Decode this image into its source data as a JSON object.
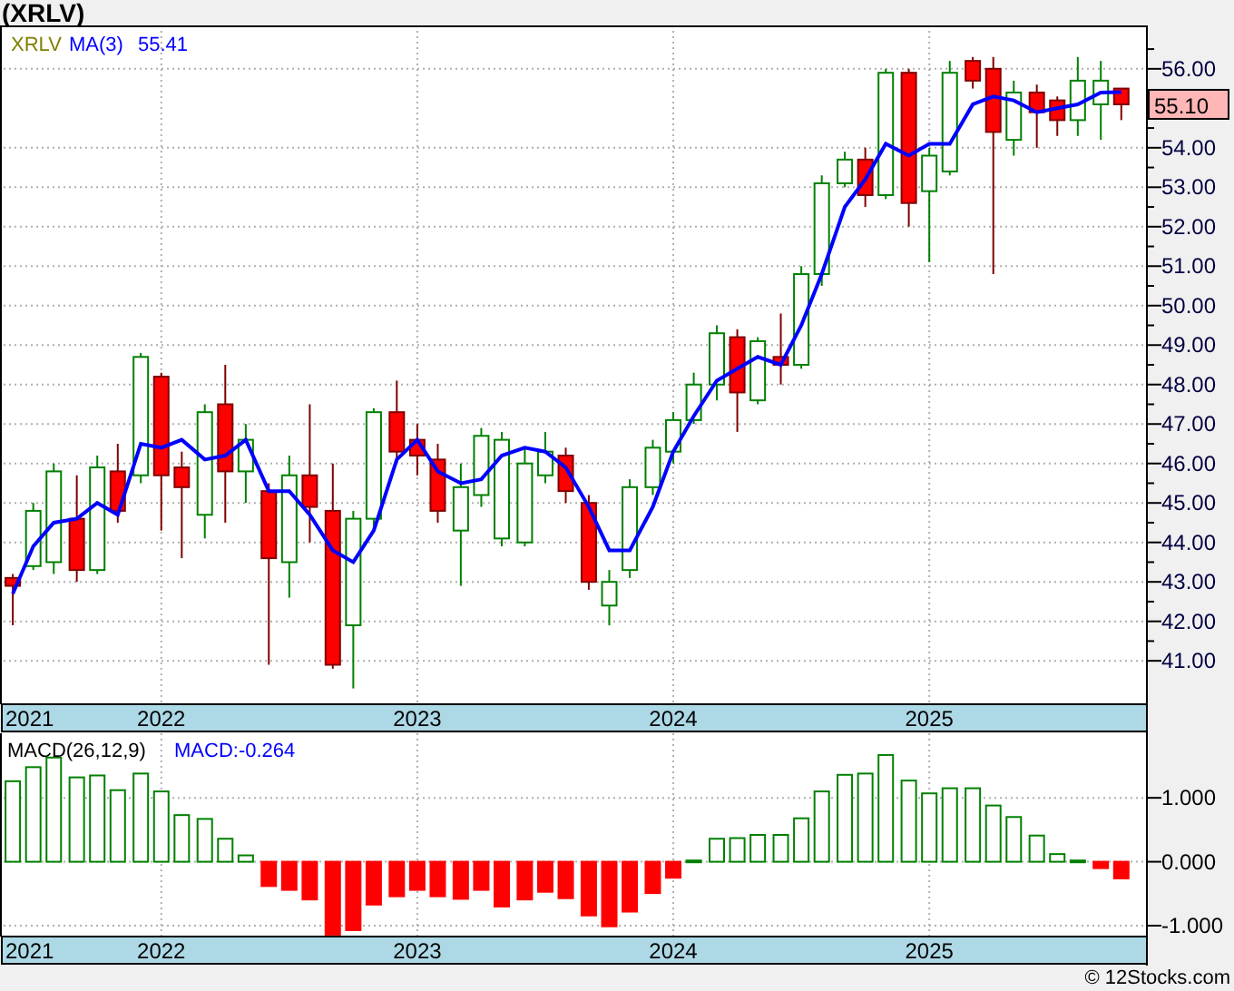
{
  "title": "(XRLV)",
  "price_panel": {
    "symbol": "XRLV",
    "ma_reading": "55.41",
    "last_price_tag": "55.10",
    "chart_data": {
      "type": "candlestick",
      "grid": true,
      "x": [
        2021.42,
        2021.5,
        2021.58,
        2021.67,
        2021.75,
        2021.83,
        2021.92,
        2022.0,
        2022.08,
        2022.17,
        2022.25,
        2022.33,
        2022.42,
        2022.5,
        2022.58,
        2022.67,
        2022.75,
        2022.83,
        2022.92,
        2023.0,
        2023.08,
        2023.17,
        2023.25,
        2023.33,
        2023.42,
        2023.5,
        2023.58,
        2023.67,
        2023.75,
        2023.83,
        2023.92,
        2024.0,
        2024.08,
        2024.17,
        2024.25,
        2024.33,
        2024.42,
        2024.5,
        2024.58,
        2024.67,
        2024.75,
        2024.83,
        2024.92,
        2025.0,
        2025.08,
        2025.17,
        2025.25,
        2025.33,
        2025.42,
        2025.5,
        2025.58,
        2025.67,
        2025.75
      ],
      "ohlc": [
        [
          43.1,
          43.2,
          41.9,
          42.9
        ],
        [
          43.4,
          45.0,
          43.3,
          44.8
        ],
        [
          43.5,
          46.0,
          43.2,
          45.8
        ],
        [
          44.6,
          45.7,
          43.0,
          43.3
        ],
        [
          43.3,
          46.2,
          43.2,
          45.9
        ],
        [
          45.8,
          46.5,
          44.5,
          44.8
        ],
        [
          45.7,
          48.8,
          45.5,
          48.7
        ],
        [
          48.2,
          48.3,
          44.3,
          45.7
        ],
        [
          45.9,
          46.3,
          43.6,
          45.4
        ],
        [
          44.7,
          47.5,
          44.1,
          47.3
        ],
        [
          47.5,
          48.5,
          44.5,
          45.8
        ],
        [
          45.8,
          47.0,
          45.0,
          46.6
        ],
        [
          45.3,
          45.5,
          40.9,
          43.6
        ],
        [
          43.5,
          46.2,
          42.6,
          45.7
        ],
        [
          45.7,
          47.5,
          44.0,
          44.9
        ],
        [
          44.8,
          46.0,
          40.8,
          40.9
        ],
        [
          41.9,
          44.8,
          40.3,
          44.6
        ],
        [
          44.6,
          47.4,
          44.3,
          47.3
        ],
        [
          47.3,
          48.1,
          46.0,
          46.3
        ],
        [
          46.6,
          47.0,
          45.7,
          46.2
        ],
        [
          46.1,
          46.5,
          44.5,
          44.8
        ],
        [
          44.3,
          46.0,
          42.9,
          45.4
        ],
        [
          45.2,
          46.9,
          44.9,
          46.7
        ],
        [
          44.1,
          46.8,
          43.9,
          46.6
        ],
        [
          44.0,
          46.4,
          43.9,
          46.0
        ],
        [
          45.7,
          46.8,
          45.5,
          46.3
        ],
        [
          46.2,
          46.4,
          45.0,
          45.3
        ],
        [
          45.0,
          45.2,
          42.8,
          43.0
        ],
        [
          42.4,
          43.3,
          41.9,
          43.0
        ],
        [
          43.3,
          45.6,
          43.1,
          45.4
        ],
        [
          45.4,
          46.6,
          45.2,
          46.4
        ],
        [
          46.3,
          47.3,
          46.0,
          47.1
        ],
        [
          47.1,
          48.3,
          47.0,
          48.0
        ],
        [
          48.0,
          49.5,
          47.6,
          49.3
        ],
        [
          49.2,
          49.4,
          46.8,
          47.8
        ],
        [
          47.6,
          49.2,
          47.5,
          49.1
        ],
        [
          48.7,
          49.8,
          48.0,
          48.5
        ],
        [
          48.5,
          51.0,
          48.4,
          50.8
        ],
        [
          50.8,
          53.3,
          50.5,
          53.1
        ],
        [
          53.1,
          53.9,
          53.0,
          53.7
        ],
        [
          53.7,
          54.0,
          52.5,
          52.8
        ],
        [
          52.8,
          56.0,
          52.7,
          55.9
        ],
        [
          55.9,
          56.0,
          52.0,
          52.6
        ],
        [
          52.9,
          54.0,
          51.1,
          53.8
        ],
        [
          53.4,
          56.2,
          53.3,
          55.9
        ],
        [
          56.2,
          56.3,
          55.5,
          55.7
        ],
        [
          56.0,
          56.3,
          50.8,
          54.4
        ],
        [
          54.2,
          55.7,
          53.8,
          55.4
        ],
        [
          55.4,
          55.6,
          54.0,
          54.9
        ],
        [
          55.2,
          55.3,
          54.3,
          54.7
        ],
        [
          54.7,
          56.3,
          54.3,
          55.7
        ],
        [
          55.1,
          56.2,
          54.2,
          55.7
        ],
        [
          55.5,
          55.5,
          54.7,
          55.1
        ]
      ],
      "xlim": [
        2021.37,
        2025.85
      ],
      "series": [
        {
          "name": "MA(3)",
          "type": "line",
          "color": "#0000ff",
          "values": [
            42.7,
            43.9,
            44.5,
            44.6,
            45.0,
            44.7,
            46.5,
            46.4,
            46.6,
            46.1,
            46.2,
            46.6,
            45.3,
            45.3,
            44.7,
            43.8,
            43.5,
            44.3,
            46.1,
            46.6,
            45.8,
            45.5,
            45.6,
            46.2,
            46.4,
            46.3,
            45.9,
            44.9,
            43.8,
            43.8,
            44.9,
            46.3,
            47.2,
            48.1,
            48.4,
            48.7,
            48.5,
            49.5,
            50.8,
            52.5,
            53.2,
            54.1,
            53.8,
            54.1,
            54.1,
            55.1,
            55.3,
            55.2,
            54.9,
            55.0,
            55.1,
            55.4,
            55.41
          ]
        }
      ],
      "ylim": [
        39.9,
        57.1
      ],
      "yticks": [
        {
          "value": 41,
          "label": "41.00"
        },
        {
          "value": 42,
          "label": "42.00"
        },
        {
          "value": 43,
          "label": "43.00"
        },
        {
          "value": 44,
          "label": "44.00"
        },
        {
          "value": 45,
          "label": "45.00"
        },
        {
          "value": 46,
          "label": "46.00"
        },
        {
          "value": 47,
          "label": "47.00"
        },
        {
          "value": 48,
          "label": "48.00"
        },
        {
          "value": 49,
          "label": "49.00"
        },
        {
          "value": 50,
          "label": "50.00"
        },
        {
          "value": 51,
          "label": "51.00"
        },
        {
          "value": 52,
          "label": "52.00"
        },
        {
          "value": 53,
          "label": "53.00"
        },
        {
          "value": 54,
          "label": "54.00"
        },
        {
          "value": 56,
          "label": "56.00"
        }
      ],
      "xticks": [
        {
          "value": 2022,
          "label": "2022"
        },
        {
          "value": 2023,
          "label": "2023"
        },
        {
          "value": 2024,
          "label": "2024"
        },
        {
          "value": 2025,
          "label": "2025"
        }
      ]
    },
    "axis_edge_label": "2021"
  },
  "macd_panel": {
    "indicator": "MACD(26,12,9)",
    "reading": "MACD:-0.264",
    "chart_data": {
      "type": "bar",
      "grid": true,
      "x": [
        2021.42,
        2021.5,
        2021.58,
        2021.67,
        2021.75,
        2021.83,
        2021.92,
        2022.0,
        2022.08,
        2022.17,
        2022.25,
        2022.33,
        2022.42,
        2022.5,
        2022.58,
        2022.67,
        2022.75,
        2022.83,
        2022.92,
        2023.0,
        2023.08,
        2023.17,
        2023.25,
        2023.33,
        2023.42,
        2023.5,
        2023.58,
        2023.67,
        2023.75,
        2023.83,
        2023.92,
        2024.0,
        2024.08,
        2024.17,
        2024.25,
        2024.33,
        2024.42,
        2024.5,
        2024.58,
        2024.67,
        2024.75,
        2024.83,
        2024.92,
        2025.0,
        2025.08,
        2025.17,
        2025.25,
        2025.33,
        2025.42,
        2025.5,
        2025.58,
        2025.67,
        2025.75
      ],
      "values": [
        1.26,
        1.48,
        1.63,
        1.32,
        1.35,
        1.12,
        1.38,
        1.1,
        0.73,
        0.67,
        0.36,
        0.1,
        -0.38,
        -0.44,
        -0.59,
        -1.14,
        -1.07,
        -0.67,
        -0.54,
        -0.44,
        -0.54,
        -0.58,
        -0.44,
        -0.7,
        -0.59,
        -0.47,
        -0.57,
        -0.84,
        -1.01,
        -0.78,
        -0.49,
        -0.25,
        0.02,
        0.36,
        0.37,
        0.42,
        0.42,
        0.68,
        1.1,
        1.36,
        1.38,
        1.67,
        1.27,
        1.07,
        1.15,
        1.15,
        0.88,
        0.7,
        0.41,
        0.12,
        0.02,
        -0.1,
        -0.26
      ],
      "xlim": [
        2021.37,
        2025.85
      ],
      "ylim": [
        -1.17,
        2.01
      ],
      "yticks": [
        {
          "value": -1,
          "label": "-1.000"
        },
        {
          "value": 0,
          "label": "0.000"
        },
        {
          "value": 1,
          "label": "1.000"
        }
      ],
      "xticks": [
        {
          "value": 2022,
          "label": "2022"
        },
        {
          "value": 2023,
          "label": "2023"
        },
        {
          "value": 2024,
          "label": "2024"
        },
        {
          "value": 2025,
          "label": "2025"
        }
      ]
    },
    "axis_edge_label": "2021"
  },
  "footer": "© 12Stocks.com"
}
